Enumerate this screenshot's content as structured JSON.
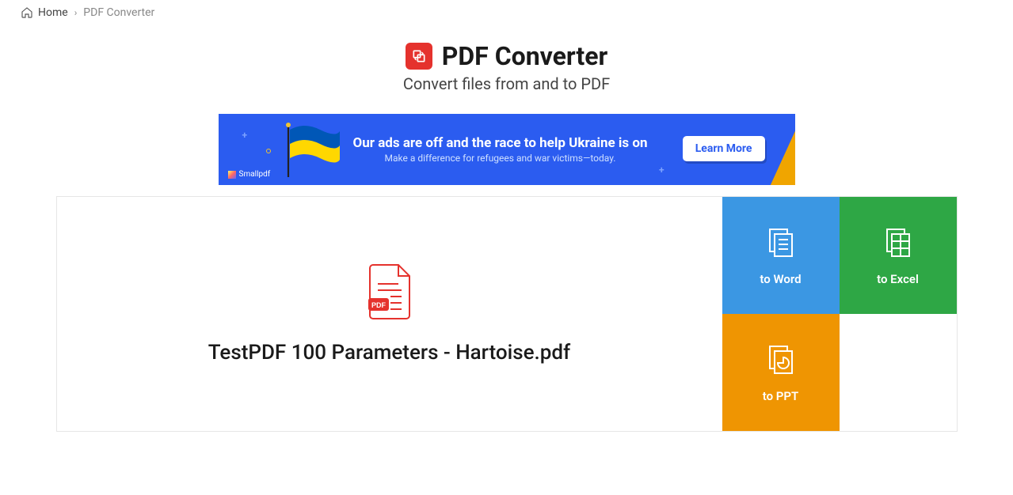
{
  "breadcrumb": {
    "home": "Home",
    "current": "PDF Converter"
  },
  "header": {
    "title": "PDF Converter",
    "subtitle": "Convert files from and to PDF"
  },
  "banner": {
    "headline": "Our ads are off and the race to help Ukraine is on",
    "sub": "Make a difference for refugees and war victims—today.",
    "cta": "Learn More",
    "brand": "Smallpdf"
  },
  "file": {
    "name": "TestPDF 100 Parameters - Hartoise.pdf"
  },
  "options": {
    "word": "to Word",
    "excel": "to Excel",
    "ppt": "to PPT"
  }
}
